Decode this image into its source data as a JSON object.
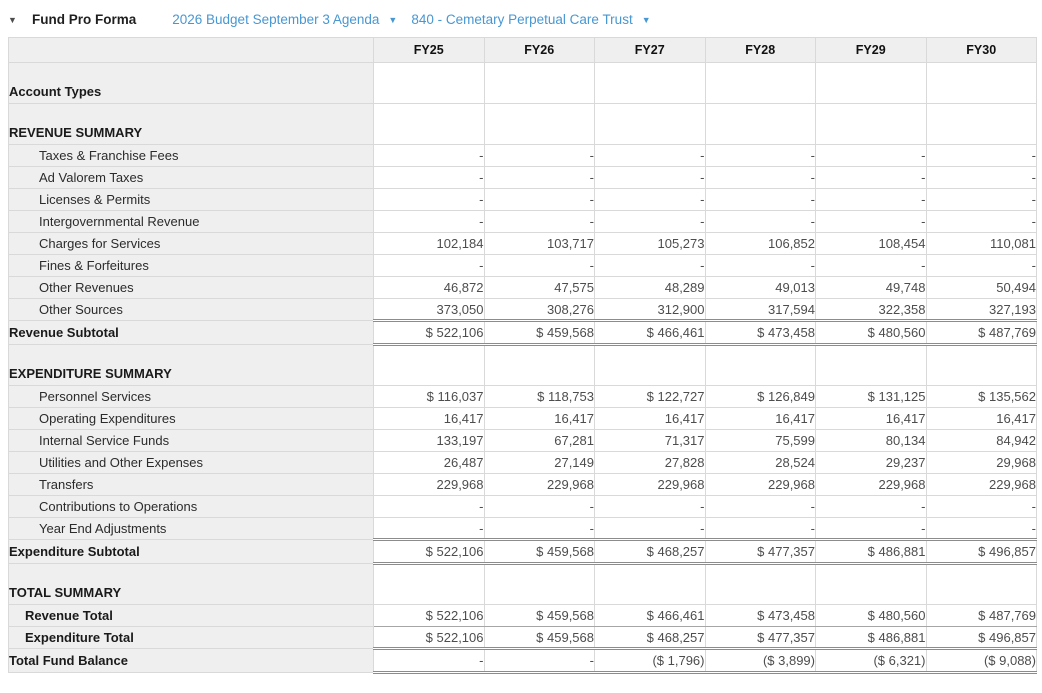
{
  "header": {
    "collapse_caret": "▼",
    "title": "Fund Pro Forma",
    "budget_dropdown": {
      "label": "2026 Budget September 3 Agenda",
      "caret": "▼"
    },
    "fund_dropdown": {
      "label": "840 - Cemetary Perpetual Care Trust",
      "caret": "▼"
    }
  },
  "colors": {
    "link_blue": "#4797d3",
    "header_gray": "#efefef",
    "double_rule": "#8c8c8c"
  },
  "table": {
    "columns": [
      "FY25",
      "FY26",
      "FY27",
      "FY28",
      "FY29",
      "FY30"
    ],
    "rows": [
      {
        "label": "Account Types",
        "type": "section",
        "values": [
          "",
          "",
          "",
          "",
          "",
          ""
        ]
      },
      {
        "label": "REVENUE SUMMARY",
        "type": "section",
        "values": [
          "",
          "",
          "",
          "",
          "",
          ""
        ]
      },
      {
        "label": "Taxes & Franchise Fees",
        "type": "detail",
        "values": [
          "-",
          "-",
          "-",
          "-",
          "-",
          "-"
        ]
      },
      {
        "label": "Ad Valorem Taxes",
        "type": "detail",
        "values": [
          "-",
          "-",
          "-",
          "-",
          "-",
          "-"
        ]
      },
      {
        "label": "Licenses & Permits",
        "type": "detail",
        "values": [
          "-",
          "-",
          "-",
          "-",
          "-",
          "-"
        ]
      },
      {
        "label": "Intergovernmental Revenue",
        "type": "detail",
        "values": [
          "-",
          "-",
          "-",
          "-",
          "-",
          "-"
        ]
      },
      {
        "label": "Charges for Services",
        "type": "detail",
        "values": [
          "102,184",
          "103,717",
          "105,273",
          "106,852",
          "108,454",
          "110,081"
        ]
      },
      {
        "label": "Fines & Forfeitures",
        "type": "detail",
        "values": [
          "-",
          "-",
          "-",
          "-",
          "-",
          "-"
        ]
      },
      {
        "label": "Other Revenues",
        "type": "detail",
        "values": [
          "46,872",
          "47,575",
          "48,289",
          "49,013",
          "49,748",
          "50,494"
        ]
      },
      {
        "label": "Other Sources",
        "type": "detail",
        "values": [
          "373,050",
          "308,276",
          "312,900",
          "317,594",
          "322,358",
          "327,193"
        ]
      },
      {
        "label": "Revenue Subtotal",
        "type": "subtotal",
        "values": [
          "$ 522,106",
          "$ 459,568",
          "$ 466,461",
          "$ 473,458",
          "$ 480,560",
          "$ 487,769"
        ]
      },
      {
        "label": "EXPENDITURE SUMMARY",
        "type": "section",
        "values": [
          "",
          "",
          "",
          "",
          "",
          ""
        ]
      },
      {
        "label": "Personnel Services",
        "type": "detail",
        "values": [
          "$ 116,037",
          "$ 118,753",
          "$ 122,727",
          "$ 126,849",
          "$ 131,125",
          "$ 135,562"
        ]
      },
      {
        "label": "Operating Expenditures",
        "type": "detail",
        "values": [
          "16,417",
          "16,417",
          "16,417",
          "16,417",
          "16,417",
          "16,417"
        ]
      },
      {
        "label": "Internal Service Funds",
        "type": "detail",
        "values": [
          "133,197",
          "67,281",
          "71,317",
          "75,599",
          "80,134",
          "84,942"
        ]
      },
      {
        "label": "Utilities and Other Expenses",
        "type": "detail",
        "values": [
          "26,487",
          "27,149",
          "27,828",
          "28,524",
          "29,237",
          "29,968"
        ]
      },
      {
        "label": "Transfers",
        "type": "detail",
        "values": [
          "229,968",
          "229,968",
          "229,968",
          "229,968",
          "229,968",
          "229,968"
        ]
      },
      {
        "label": "Contributions to Operations",
        "type": "detail",
        "values": [
          "-",
          "-",
          "-",
          "-",
          "-",
          "-"
        ]
      },
      {
        "label": "Year End Adjustments",
        "type": "detail",
        "values": [
          "-",
          "-",
          "-",
          "-",
          "-",
          "-"
        ]
      },
      {
        "label": "Expenditure Subtotal",
        "type": "subtotal",
        "values": [
          "$ 522,106",
          "$ 459,568",
          "$ 468,257",
          "$ 477,357",
          "$ 486,881",
          "$ 496,857"
        ]
      },
      {
        "label": "TOTAL SUMMARY",
        "type": "section",
        "values": [
          "",
          "",
          "",
          "",
          "",
          ""
        ]
      },
      {
        "label": "Revenue Total",
        "type": "total",
        "values": [
          "$ 522,106",
          "$ 459,568",
          "$ 466,461",
          "$ 473,458",
          "$ 480,560",
          "$ 487,769"
        ]
      },
      {
        "label": "Expenditure Total",
        "type": "total",
        "values": [
          "$ 522,106",
          "$ 459,568",
          "$ 468,257",
          "$ 477,357",
          "$ 486,881",
          "$ 496,857"
        ]
      },
      {
        "label": "Total Fund Balance",
        "type": "grand",
        "values": [
          "-",
          "-",
          "($ 1,796)",
          "($ 3,899)",
          "($ 6,321)",
          "($ 9,088)"
        ]
      }
    ]
  }
}
